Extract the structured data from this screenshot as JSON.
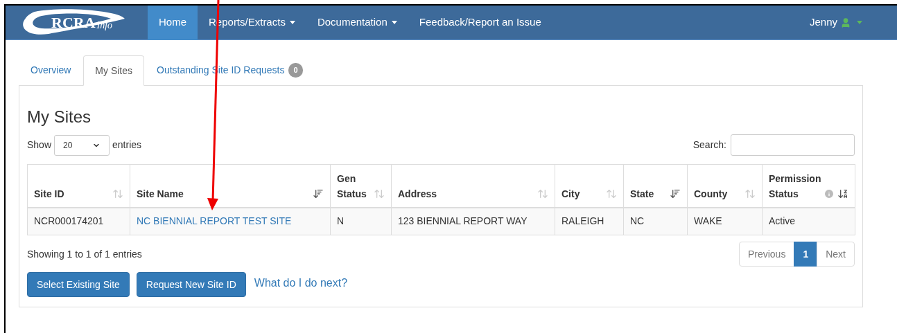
{
  "navbar": {
    "brand": {
      "main": "RCRA",
      "sub": "Info"
    },
    "items": [
      {
        "label": "Home",
        "selected": true,
        "dropdown": false
      },
      {
        "label": "Reports/Extracts",
        "selected": false,
        "dropdown": true
      },
      {
        "label": "Documentation",
        "selected": false,
        "dropdown": true
      },
      {
        "label": "Feedback/Report an Issue",
        "selected": false,
        "dropdown": false
      }
    ],
    "user": "Jenny"
  },
  "tabs": [
    {
      "label": "Overview",
      "selected": false
    },
    {
      "label": "My Sites",
      "selected": true
    },
    {
      "label": "Outstanding Site ID Requests",
      "selected": false,
      "badge": "0"
    }
  ],
  "panel": {
    "title": "My Sites",
    "length": {
      "before": "Show",
      "value": "20",
      "after": "entries"
    },
    "search": {
      "label": "Search:"
    },
    "table": {
      "columns": [
        {
          "label": "Site ID",
          "kind": "unsorted",
          "info": false
        },
        {
          "label": "Site Name",
          "kind": "ascending",
          "info": false
        },
        {
          "label": "Gen Status",
          "kind": "unsorted",
          "info": false
        },
        {
          "label": "Address",
          "kind": "unsorted",
          "info": false
        },
        {
          "label": "City",
          "kind": "unsorted",
          "info": false
        },
        {
          "label": "State",
          "kind": "ascending",
          "info": false
        },
        {
          "label": "County",
          "kind": "unsorted",
          "info": false
        },
        {
          "label": "Permission Status",
          "kind": "descending",
          "info": true
        }
      ],
      "rows": [
        [
          "NCR000174201",
          "NC BIENNIAL REPORT TEST SITE",
          "N",
          "123 BIENNIAL REPORT WAY",
          "RALEIGH",
          "NC",
          "WAKE",
          "Active"
        ]
      ]
    },
    "info": "Showing 1 to 1 of 1 entries",
    "pagination": [
      {
        "label": "Previous",
        "selected": false
      },
      {
        "label": "1",
        "selected": true
      },
      {
        "label": "Next",
        "selected": false
      }
    ],
    "buttons": [
      "Select Existing Site",
      "Request New Site ID"
    ],
    "help_link": "What do I do next?"
  }
}
